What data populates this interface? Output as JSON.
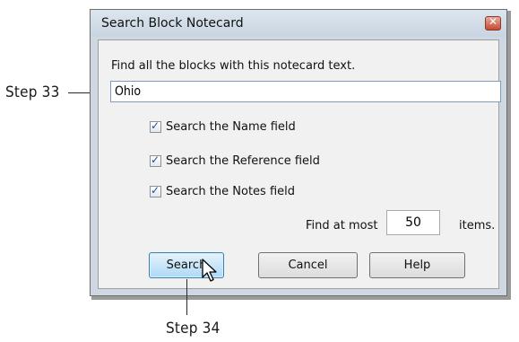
{
  "callouts": {
    "step33": "Step 33",
    "step34": "Step 34"
  },
  "dialog": {
    "title": "Search Block Notecard",
    "close_icon": "close-icon",
    "prompt": "Find all the blocks with this notecard text.",
    "search_text": "Ohio",
    "options": [
      {
        "label": "Search the Name field",
        "checked": true
      },
      {
        "label": "Search the Reference field",
        "checked": true
      },
      {
        "label": "Search the Notes field",
        "checked": true
      }
    ],
    "find_at_most_label": "Find at most",
    "find_at_most_value": "50",
    "items_label": "items.",
    "buttons": {
      "search": "Search",
      "cancel": "Cancel",
      "help": "Help"
    }
  }
}
